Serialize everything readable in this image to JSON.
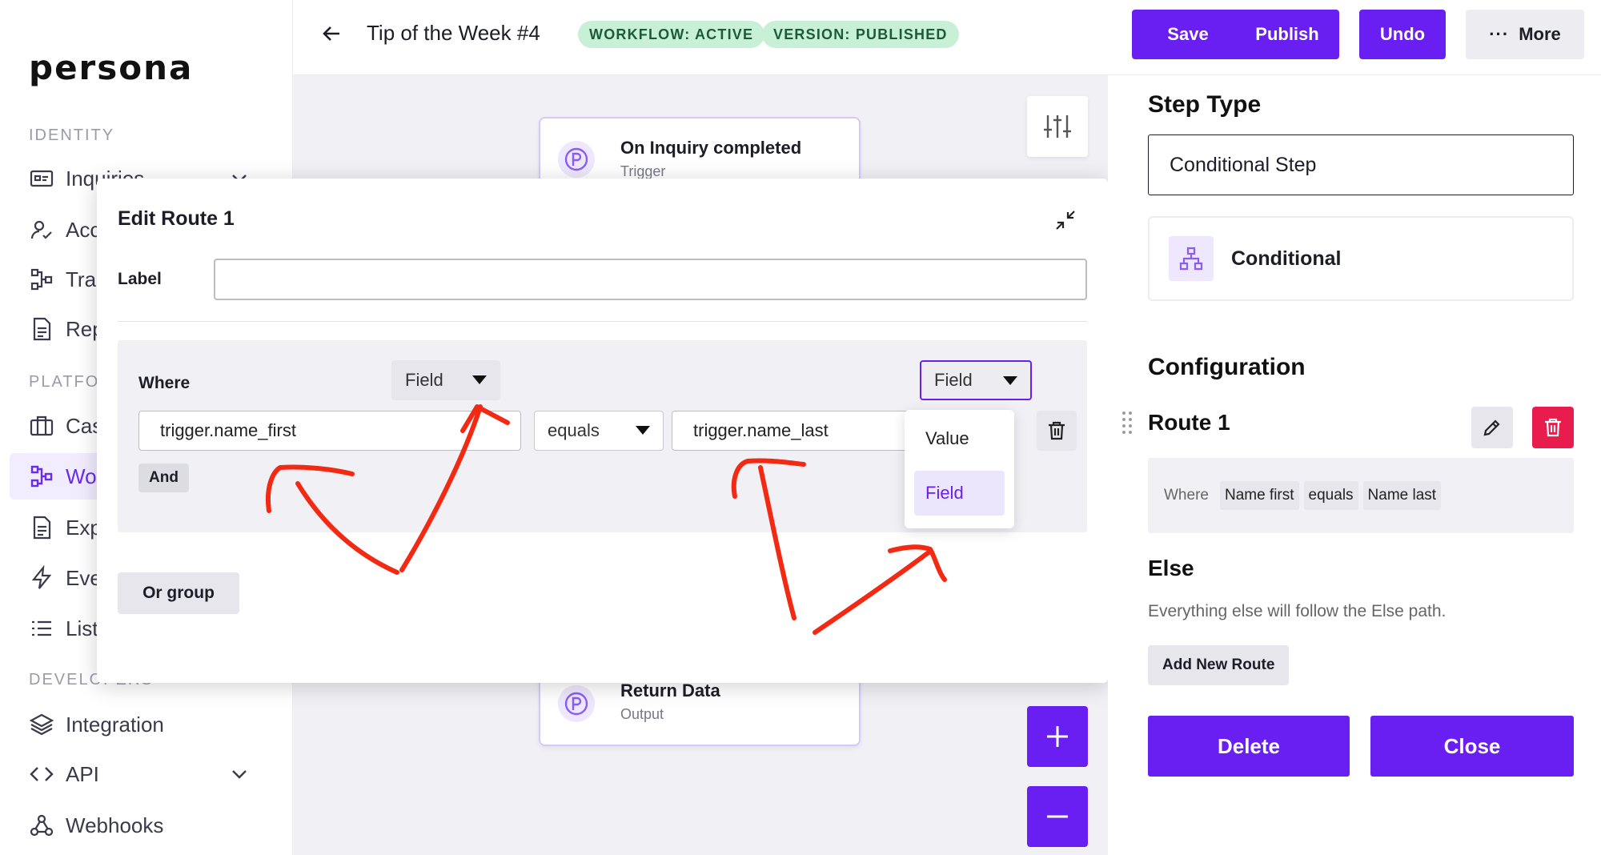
{
  "colors": {
    "accent": "#6a1ff2",
    "badge_bg": "#c8f0d6",
    "danger": "#e81d4e",
    "annotation": "#f22a14"
  },
  "sidebar": {
    "logo": "persona",
    "sections": {
      "identity": "IDENTITY",
      "platform": "PLATFO",
      "developers": "DEVELOPERS"
    },
    "items": [
      {
        "label": "Inquiries",
        "icon": "id-card-icon"
      },
      {
        "label": "Acc",
        "icon": "user-check-icon"
      },
      {
        "label": "Tra",
        "icon": "transactions-icon"
      },
      {
        "label": "Rep",
        "icon": "document-icon"
      },
      {
        "label": "Cas",
        "icon": "briefcase-icon"
      },
      {
        "label": "Wor",
        "icon": "workflow-icon"
      },
      {
        "label": "Exp",
        "icon": "export-icon"
      },
      {
        "label": "Eve",
        "icon": "lightning-icon"
      },
      {
        "label": "List",
        "icon": "list-icon"
      },
      {
        "label": "Integration",
        "icon": "layers-icon"
      },
      {
        "label": "API",
        "icon": "code-icon"
      },
      {
        "label": "Webhooks",
        "icon": "webhooks-icon"
      }
    ]
  },
  "header": {
    "title": "Tip of the Week #4",
    "badges": [
      "WORKFLOW: ACTIVE",
      "VERSION: PUBLISHED"
    ],
    "buttons": {
      "save": "Save",
      "publish": "Publish",
      "undo": "Undo",
      "more": "More"
    }
  },
  "canvas": {
    "trigger_node": {
      "title": "On Inquiry completed",
      "subtitle": "Trigger"
    },
    "output_node": {
      "title": "Return Data",
      "subtitle": "Output"
    }
  },
  "modal": {
    "title": "Edit Route 1",
    "label_field": {
      "label": "Label",
      "value": ""
    },
    "where": "Where",
    "left_type": "Field",
    "left_value": "trigger.name_first",
    "operator": "equals",
    "right_type": "Field",
    "right_value": "trigger.name_last",
    "dropdown_options": [
      "Value",
      "Field"
    ],
    "dropdown_selected": "Field",
    "and_button": "And",
    "or_group_button": "Or group"
  },
  "right_panel": {
    "step_type_heading": "Step Type",
    "step_type_value": "Conditional Step",
    "step_card_label": "Conditional",
    "configuration_heading": "Configuration",
    "route_title": "Route 1",
    "route_summary": {
      "where": "Where",
      "chips": [
        "Name first",
        "equals",
        "Name last"
      ]
    },
    "else_heading": "Else",
    "else_text": "Everything else will follow the Else path.",
    "add_route_button": "Add New Route",
    "delete_button": "Delete",
    "close_button": "Close"
  }
}
